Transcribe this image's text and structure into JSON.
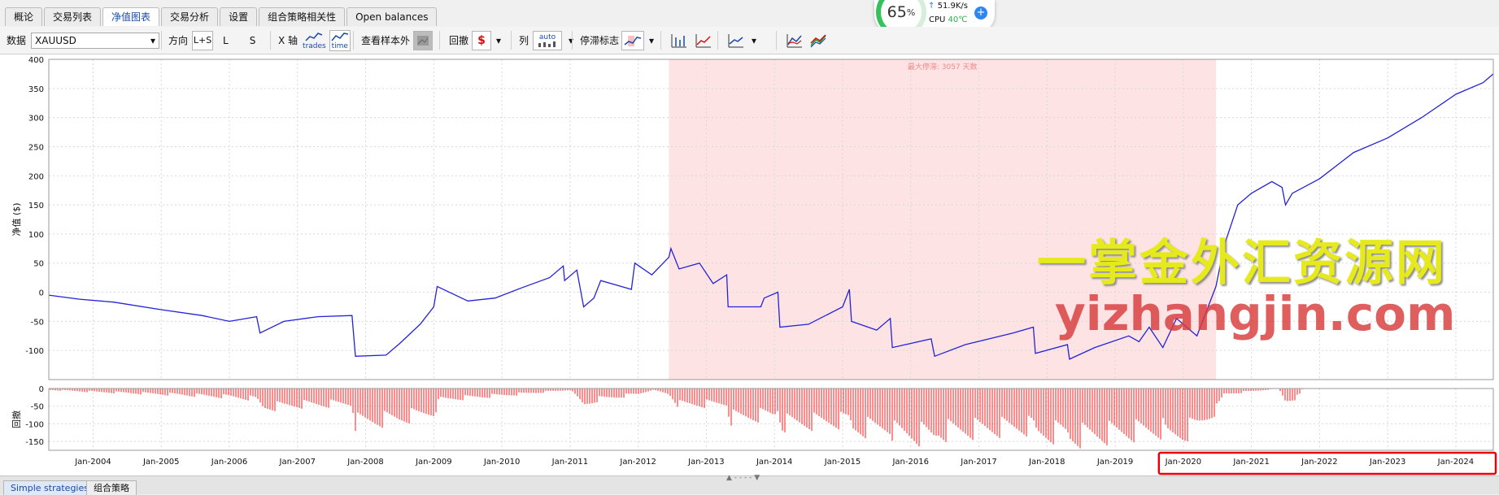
{
  "tabs": [
    "概论",
    "交易列表",
    "净值图表",
    "交易分析",
    "设置",
    "组合策略相关性",
    "Open balances"
  ],
  "active_tab": 2,
  "toolbar": {
    "data_label": "数据",
    "symbol": "XAUUSD",
    "direction_label": "方向",
    "dir_both": "L+S",
    "dir_long": "L",
    "dir_short": "S",
    "xaxis_label": "X 轴",
    "xaxis_trades": "trades",
    "xaxis_time": "time",
    "oos_label": "查看样本外",
    "drawdown_label": "回撤",
    "drawdown_unit": "$",
    "columns_label": "列",
    "columns_auto": "auto",
    "stagnation_label": "停滞标志"
  },
  "system_widget": {
    "cpu_percent": "65",
    "percent_sign": "%",
    "net_speed": "51.9K/s",
    "cpu_label": "CPU",
    "temp": "40℃"
  },
  "bottom_tabs": [
    "Simple strategies",
    "组合策略"
  ],
  "watermark": {
    "line1": "一掌金外汇资源网",
    "line2": "yizhangjin.com"
  },
  "chart_data": {
    "type": "line",
    "main": {
      "ylabel": "净值 ($)",
      "ylim": [
        -150,
        400
      ],
      "yticks": [
        400,
        350,
        300,
        250,
        200,
        150,
        100,
        50,
        0,
        -50,
        -100
      ],
      "line_color": "#2323d6",
      "stagnation": {
        "start": 2012.45,
        "end": 2020.48,
        "label": "最大停滞: 3057 天数",
        "color": "#fde3e3"
      },
      "series": [
        {
          "x": [
            2003.35,
            2003.8,
            2004.3,
            2005.0,
            2005.6,
            2006.0,
            2006.4,
            2006.45,
            2006.8,
            2007.3,
            2007.8,
            2007.85,
            2008.3,
            2008.5,
            2008.8,
            2009.0,
            2009.05,
            2009.5,
            2009.9,
            2010.3,
            2010.7,
            2010.9,
            2010.92,
            2011.1,
            2011.2,
            2011.35,
            2011.45,
            2011.9,
            2011.95,
            2012.2,
            2012.45,
            2012.48,
            2012.6,
            2012.9,
            2013.1,
            2013.3,
            2013.32,
            2013.8,
            2013.85,
            2014.05,
            2014.08,
            2014.5,
            2015.0,
            2015.1,
            2015.13,
            2015.5,
            2015.7,
            2015.73,
            2016.3,
            2016.35,
            2016.8,
            2017.5,
            2017.8,
            2017.83,
            2018.3,
            2018.33,
            2018.7,
            2019.2,
            2019.35,
            2019.5,
            2019.7,
            2019.9,
            2020.2,
            2020.48,
            2020.6,
            2020.8,
            2021.0,
            2021.3,
            2021.45,
            2021.5,
            2021.6,
            2022.0,
            2022.5,
            2023.0,
            2023.5,
            2024.0,
            2024.4,
            2024.55
          ],
          "y": [
            -5,
            -12,
            -17,
            -30,
            -40,
            -50,
            -42,
            -70,
            -50,
            -42,
            -40,
            -110,
            -108,
            -88,
            -55,
            -25,
            10,
            -15,
            -10,
            8,
            25,
            45,
            20,
            38,
            -25,
            -10,
            20,
            5,
            50,
            30,
            60,
            75,
            40,
            50,
            15,
            30,
            -25,
            -25,
            -10,
            0,
            -60,
            -55,
            -25,
            5,
            -50,
            -65,
            -45,
            -95,
            -80,
            -110,
            -90,
            -70,
            -60,
            -105,
            -90,
            -115,
            -95,
            -75,
            -85,
            -60,
            -95,
            -45,
            -75,
            10,
            80,
            150,
            170,
            190,
            180,
            150,
            170,
            195,
            240,
            265,
            300,
            340,
            360,
            375
          ]
        }
      ]
    },
    "underwater": {
      "ylabel": "回撤",
      "ylim": [
        -175,
        0
      ],
      "yticks": [
        0,
        -50,
        -100,
        -150
      ],
      "ytick_labels": [
        "0",
        "-50",
        "-100",
        "-150"
      ],
      "bar_color": "#ff1a1a",
      "series": [
        {
          "x": [
            2003.35,
            2004.0,
            2005.0,
            2006.0,
            2006.4,
            2006.5,
            2007.0,
            2007.8,
            2007.85,
            2008.5,
            2009.0,
            2009.1,
            2010.0,
            2010.5,
            2011.0,
            2011.2,
            2011.4,
            2012.0,
            2012.2,
            2012.45,
            2012.6,
            2013.3,
            2013.35,
            2014.0,
            2014.05,
            2014.1,
            2015.0,
            2015.1,
            2015.15,
            2015.7,
            2015.75,
            2016.35,
            2016.4,
            2017.0,
            2017.8,
            2017.85,
            2018.3,
            2018.33,
            2019.0,
            2019.7,
            2019.75,
            2020.0,
            2020.2,
            2020.5,
            2020.6,
            2021.4,
            2021.5,
            2021.7,
            2021.75,
            2024.55
          ],
          "y": [
            -5,
            -12,
            -20,
            -30,
            -38,
            -70,
            -60,
            -55,
            -125,
            -110,
            -85,
            -40,
            -25,
            -15,
            -5,
            -60,
            -40,
            -20,
            -5,
            -20,
            -60,
            -55,
            -110,
            -95,
            -75,
            -130,
            -120,
            -110,
            -150,
            -140,
            -165,
            -175,
            -160,
            -150,
            -140,
            -170,
            -160,
            -180,
            -165,
            -150,
            -180,
            -165,
            -135,
            -75,
            -20,
            0,
            -45,
            -30,
            0,
            0
          ]
        }
      ]
    },
    "x_ticks": [
      "Jan-2004",
      "Jan-2005",
      "Jan-2006",
      "Jan-2007",
      "Jan-2008",
      "Jan-2009",
      "Jan-2010",
      "Jan-2011",
      "Jan-2012",
      "Jan-2013",
      "Jan-2014",
      "Jan-2015",
      "Jan-2016",
      "Jan-2017",
      "Jan-2018",
      "Jan-2019",
      "Jan-2020",
      "Jan-2021",
      "Jan-2022",
      "Jan-2023",
      "Jan-2024"
    ],
    "xlim": [
      2003.35,
      2024.55
    ],
    "highlight_box": {
      "from": "Jan-2020",
      "to": "Jan-2024",
      "color": "#e8000a"
    }
  }
}
